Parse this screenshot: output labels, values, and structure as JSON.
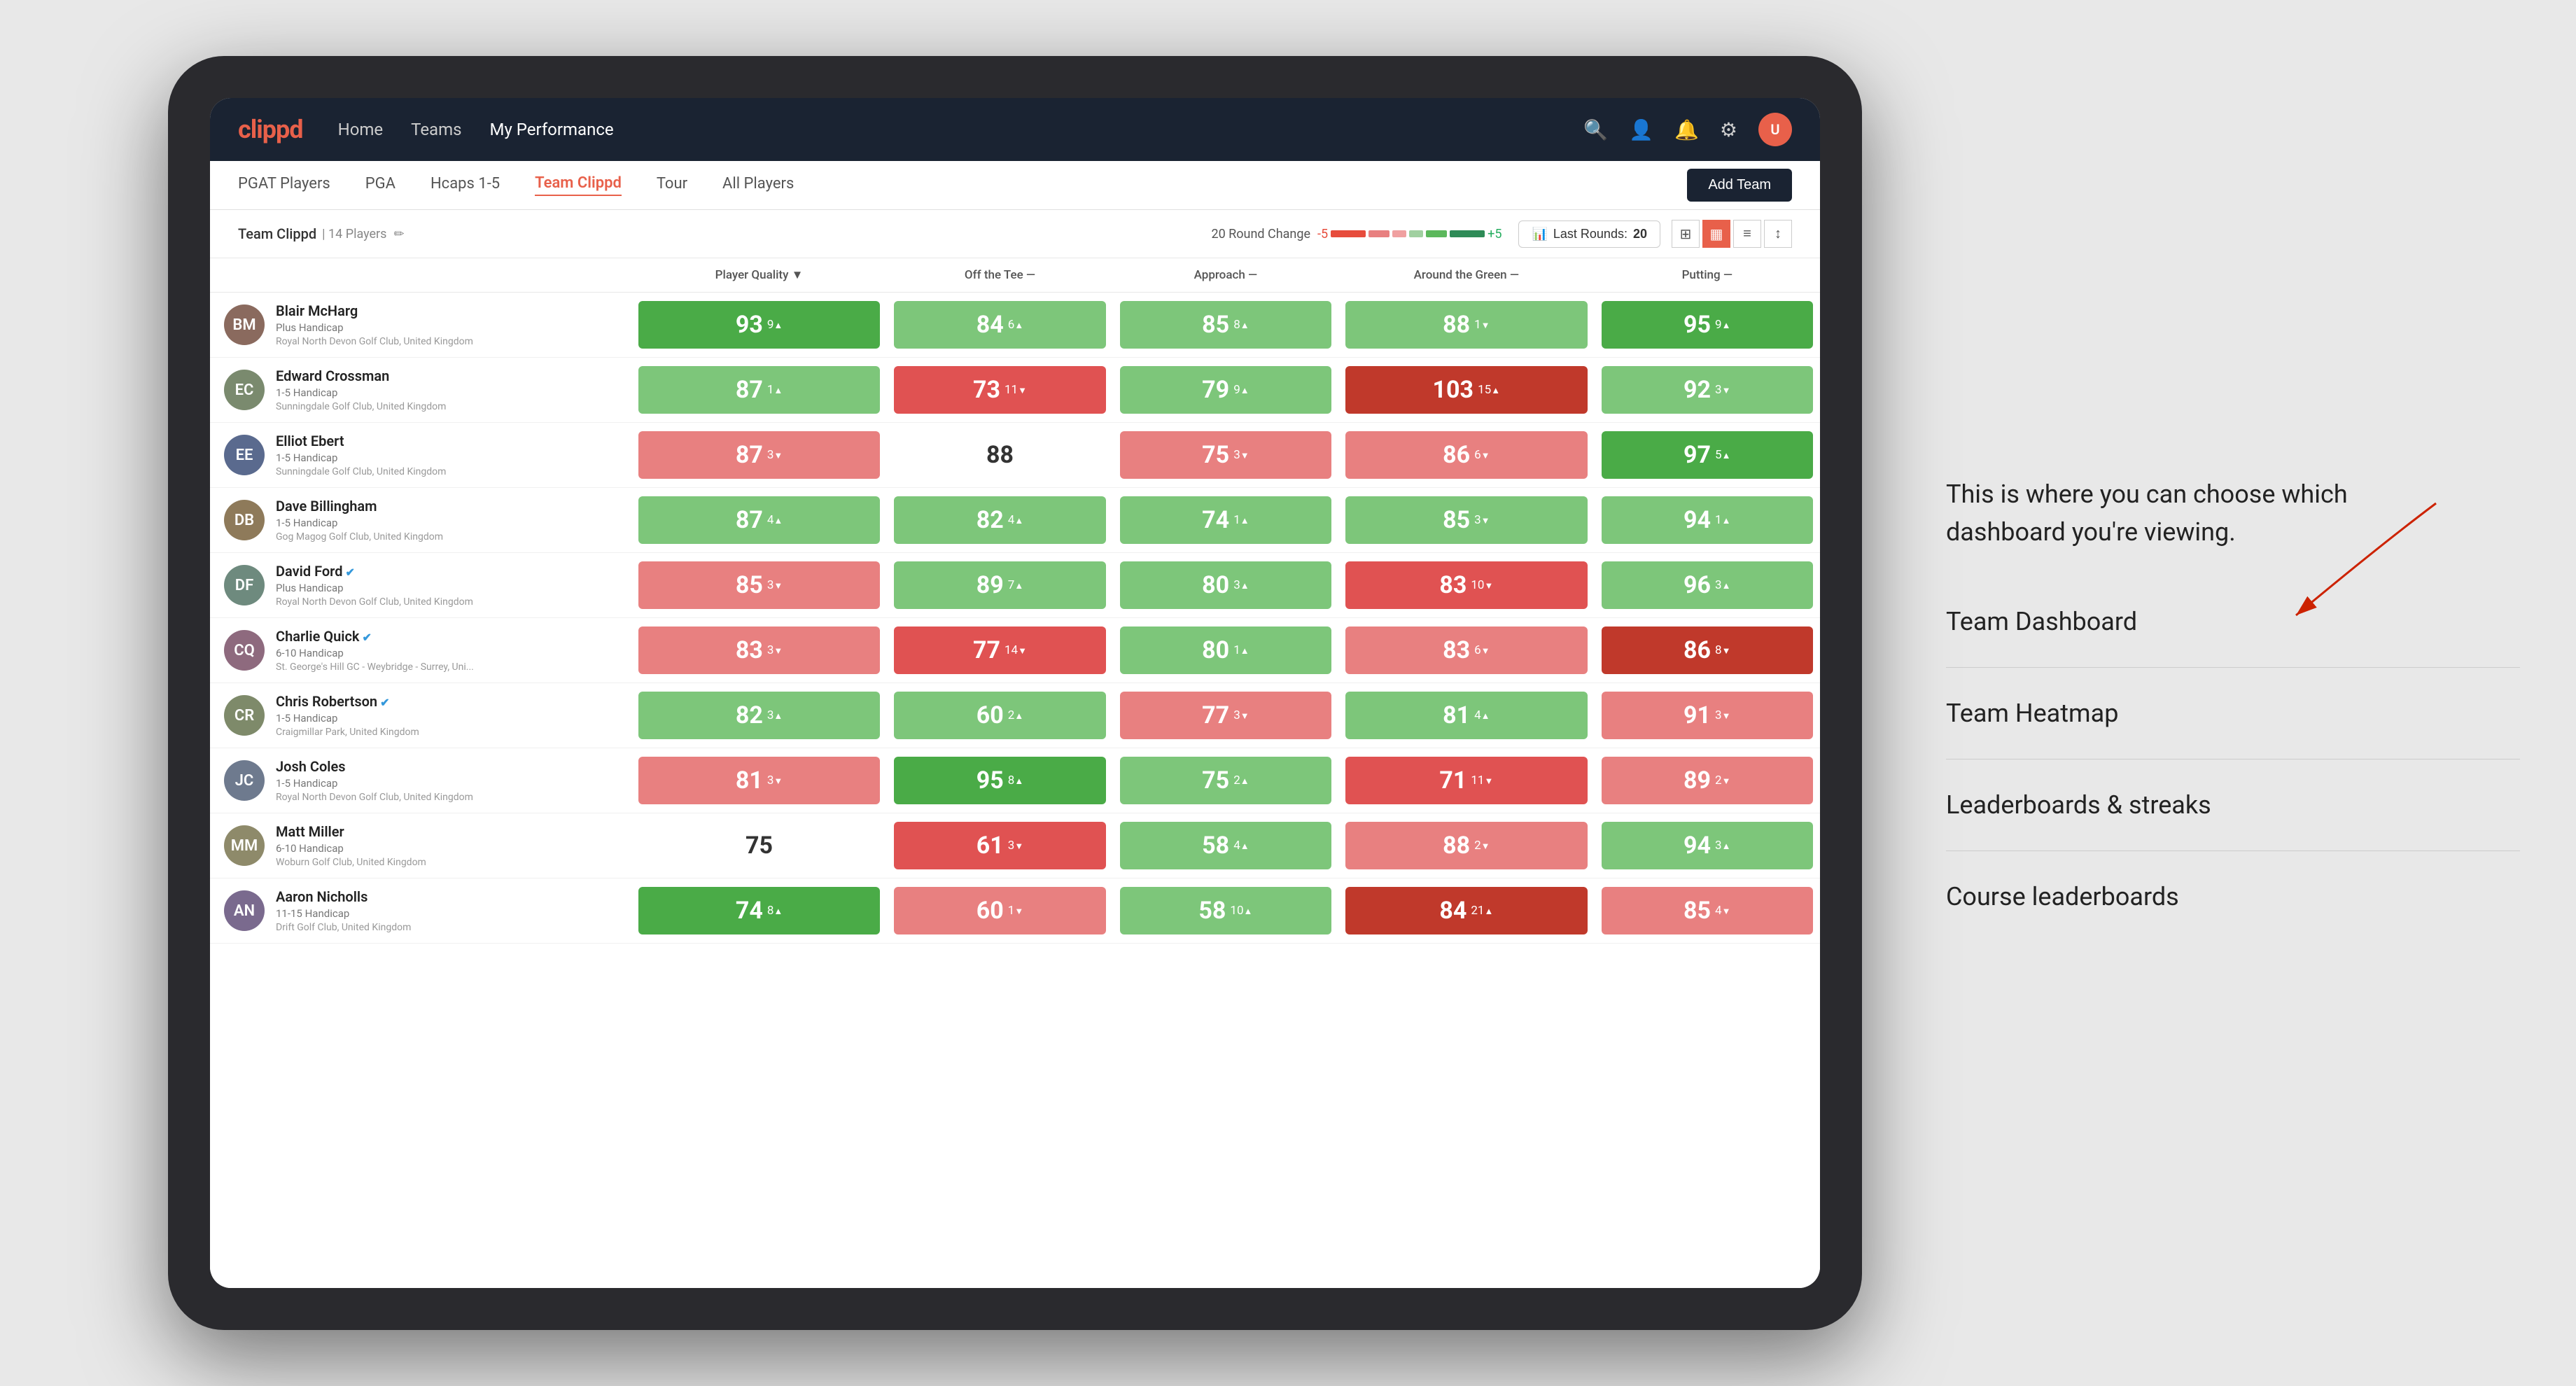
{
  "annotation": {
    "intro_text": "This is where you can choose which dashboard you're viewing.",
    "items": [
      "Team Dashboard",
      "Team Heatmap",
      "Leaderboards & streaks",
      "Course leaderboards"
    ]
  },
  "nav": {
    "logo": "clippd",
    "links": [
      "Home",
      "Teams",
      "My Performance"
    ],
    "active_link": "My Performance"
  },
  "sub_nav": {
    "links": [
      "PGAT Players",
      "PGA",
      "Hcaps 1-5",
      "Team Clippd",
      "Tour",
      "All Players"
    ],
    "active_link": "Team Clippd",
    "add_team_label": "Add Team"
  },
  "team_header": {
    "name": "Team Clippd",
    "separator": "|",
    "count": "14 Players",
    "round_change_label": "20 Round Change",
    "change_neg": "-5",
    "change_pos": "+5",
    "last_rounds_label": "Last Rounds:",
    "last_rounds_value": "20"
  },
  "table": {
    "columns": {
      "player": "Player Quality ▼",
      "tee": "Off the Tee —",
      "approach": "Approach —",
      "around": "Around the Green —",
      "putting": "Putting —"
    },
    "rows": [
      {
        "name": "Blair McHarg",
        "handicap": "Plus Handicap",
        "club": "Royal North Devon Golf Club, United Kingdom",
        "avatar_color": "#8a6a5e",
        "initials": "BM",
        "scores": {
          "quality": {
            "value": "93",
            "change": "9",
            "dir": "up",
            "color": "green"
          },
          "tee": {
            "value": "84",
            "change": "6",
            "dir": "up",
            "color": "light-green"
          },
          "approach": {
            "value": "85",
            "change": "8",
            "dir": "up",
            "color": "light-green"
          },
          "around": {
            "value": "88",
            "change": "1",
            "dir": "down",
            "color": "light-green"
          },
          "putting": {
            "value": "95",
            "change": "9",
            "dir": "up",
            "color": "green"
          }
        }
      },
      {
        "name": "Edward Crossman",
        "handicap": "1-5 Handicap",
        "club": "Sunningdale Golf Club, United Kingdom",
        "avatar_color": "#7a8a6e",
        "initials": "EC",
        "scores": {
          "quality": {
            "value": "87",
            "change": "1",
            "dir": "up",
            "color": "light-green"
          },
          "tee": {
            "value": "73",
            "change": "11",
            "dir": "down",
            "color": "red"
          },
          "approach": {
            "value": "79",
            "change": "9",
            "dir": "up",
            "color": "light-green"
          },
          "around": {
            "value": "103",
            "change": "15",
            "dir": "up",
            "color": "dark-red"
          },
          "putting": {
            "value": "92",
            "change": "3",
            "dir": "down",
            "color": "light-green"
          }
        }
      },
      {
        "name": "Elliot Ebert",
        "handicap": "1-5 Handicap",
        "club": "Sunningdale Golf Club, United Kingdom",
        "avatar_color": "#5a6a8e",
        "initials": "EE",
        "scores": {
          "quality": {
            "value": "87",
            "change": "3",
            "dir": "down",
            "color": "light-red"
          },
          "tee": {
            "value": "88",
            "change": "",
            "dir": "",
            "color": "white"
          },
          "approach": {
            "value": "75",
            "change": "3",
            "dir": "down",
            "color": "light-red"
          },
          "around": {
            "value": "86",
            "change": "6",
            "dir": "down",
            "color": "light-red"
          },
          "putting": {
            "value": "97",
            "change": "5",
            "dir": "up",
            "color": "green"
          }
        }
      },
      {
        "name": "Dave Billingham",
        "handicap": "1-5 Handicap",
        "club": "Gog Magog Golf Club, United Kingdom",
        "avatar_color": "#8e7a5a",
        "initials": "DB",
        "scores": {
          "quality": {
            "value": "87",
            "change": "4",
            "dir": "up",
            "color": "light-green"
          },
          "tee": {
            "value": "82",
            "change": "4",
            "dir": "up",
            "color": "light-green"
          },
          "approach": {
            "value": "74",
            "change": "1",
            "dir": "up",
            "color": "light-green"
          },
          "around": {
            "value": "85",
            "change": "3",
            "dir": "down",
            "color": "light-green"
          },
          "putting": {
            "value": "94",
            "change": "1",
            "dir": "up",
            "color": "light-green"
          }
        }
      },
      {
        "name": "David Ford",
        "handicap": "Plus Handicap",
        "club": "Royal North Devon Golf Club, United Kingdom",
        "avatar_color": "#6e8a7e",
        "initials": "DF",
        "verified": true,
        "scores": {
          "quality": {
            "value": "85",
            "change": "3",
            "dir": "down",
            "color": "light-red"
          },
          "tee": {
            "value": "89",
            "change": "7",
            "dir": "up",
            "color": "light-green"
          },
          "approach": {
            "value": "80",
            "change": "3",
            "dir": "up",
            "color": "light-green"
          },
          "around": {
            "value": "83",
            "change": "10",
            "dir": "down",
            "color": "red"
          },
          "putting": {
            "value": "96",
            "change": "3",
            "dir": "up",
            "color": "light-green"
          }
        }
      },
      {
        "name": "Charlie Quick",
        "handicap": "6-10 Handicap",
        "club": "St. George's Hill GC - Weybridge - Surrey, Uni...",
        "avatar_color": "#8e6a7e",
        "initials": "CQ",
        "verified": true,
        "scores": {
          "quality": {
            "value": "83",
            "change": "3",
            "dir": "down",
            "color": "light-red"
          },
          "tee": {
            "value": "77",
            "change": "14",
            "dir": "down",
            "color": "red"
          },
          "approach": {
            "value": "80",
            "change": "1",
            "dir": "up",
            "color": "light-green"
          },
          "around": {
            "value": "83",
            "change": "6",
            "dir": "down",
            "color": "light-red"
          },
          "putting": {
            "value": "86",
            "change": "8",
            "dir": "down",
            "color": "dark-red"
          }
        }
      },
      {
        "name": "Chris Robertson",
        "handicap": "1-5 Handicap",
        "club": "Craigmillar Park, United Kingdom",
        "avatar_color": "#7e8a6a",
        "initials": "CR",
        "verified": true,
        "scores": {
          "quality": {
            "value": "82",
            "change": "3",
            "dir": "up",
            "color": "light-green"
          },
          "tee": {
            "value": "60",
            "change": "2",
            "dir": "up",
            "color": "light-green"
          },
          "approach": {
            "value": "77",
            "change": "3",
            "dir": "down",
            "color": "light-red"
          },
          "around": {
            "value": "81",
            "change": "4",
            "dir": "up",
            "color": "light-green"
          },
          "putting": {
            "value": "91",
            "change": "3",
            "dir": "down",
            "color": "light-red"
          }
        }
      },
      {
        "name": "Josh Coles",
        "handicap": "1-5 Handicap",
        "club": "Royal North Devon Golf Club, United Kingdom",
        "avatar_color": "#6e7a8e",
        "initials": "JC",
        "scores": {
          "quality": {
            "value": "81",
            "change": "3",
            "dir": "down",
            "color": "light-red"
          },
          "tee": {
            "value": "95",
            "change": "8",
            "dir": "up",
            "color": "green"
          },
          "approach": {
            "value": "75",
            "change": "2",
            "dir": "up",
            "color": "light-green"
          },
          "around": {
            "value": "71",
            "change": "11",
            "dir": "down",
            "color": "red"
          },
          "putting": {
            "value": "89",
            "change": "2",
            "dir": "down",
            "color": "light-red"
          }
        }
      },
      {
        "name": "Matt Miller",
        "handicap": "6-10 Handicap",
        "club": "Woburn Golf Club, United Kingdom",
        "avatar_color": "#8e8a6a",
        "initials": "MM",
        "scores": {
          "quality": {
            "value": "75",
            "change": "",
            "dir": "",
            "color": "white"
          },
          "tee": {
            "value": "61",
            "change": "3",
            "dir": "down",
            "color": "red"
          },
          "approach": {
            "value": "58",
            "change": "4",
            "dir": "up",
            "color": "light-green"
          },
          "around": {
            "value": "88",
            "change": "2",
            "dir": "down",
            "color": "light-red"
          },
          "putting": {
            "value": "94",
            "change": "3",
            "dir": "up",
            "color": "light-green"
          }
        }
      },
      {
        "name": "Aaron Nicholls",
        "handicap": "11-15 Handicap",
        "club": "Drift Golf Club, United Kingdom",
        "avatar_color": "#7a6a8e",
        "initials": "AN",
        "scores": {
          "quality": {
            "value": "74",
            "change": "8",
            "dir": "up",
            "color": "green"
          },
          "tee": {
            "value": "60",
            "change": "1",
            "dir": "down",
            "color": "light-red"
          },
          "approach": {
            "value": "58",
            "change": "10",
            "dir": "up",
            "color": "light-green"
          },
          "around": {
            "value": "84",
            "change": "21",
            "dir": "up",
            "color": "dark-red"
          },
          "putting": {
            "value": "85",
            "change": "4",
            "dir": "down",
            "color": "light-red"
          }
        }
      }
    ]
  }
}
